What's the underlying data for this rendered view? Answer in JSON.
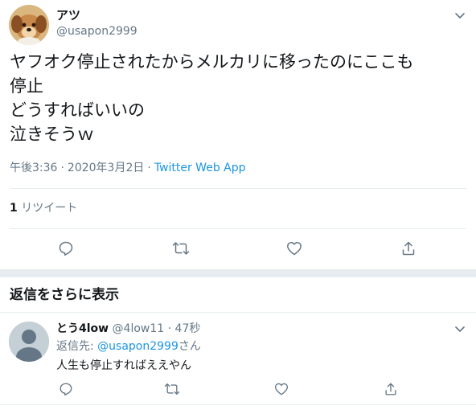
{
  "main_tweet": {
    "author_name": "アツ",
    "author_handle": "@usapon2999",
    "text_lines": [
      "ヤフオク停止されたからメルカリに移ったのにここも",
      "停止",
      "どうすればいいの",
      "泣きそうｗ"
    ],
    "time": "午後3:36",
    "separator": "·",
    "date": "2020年3月2日",
    "client": "Twitter Web App",
    "retweet_count": "1",
    "retweet_label": "リツイート"
  },
  "more_replies_label": "返信をさらに表示",
  "reply": {
    "author_name": "とう4low",
    "author_handle": "@4low11",
    "separator": "·",
    "time": "47秒",
    "reply_to_prefix": "返信先: ",
    "reply_to_handle": "@usapon2999",
    "reply_to_suffix": "さん",
    "text": "人生も停止すればええやん"
  },
  "icons": {
    "reply": "comment-icon",
    "retweet": "retweet-icon",
    "like": "heart-icon",
    "share": "share-icon",
    "menu": "chevron-down-icon"
  },
  "colors": {
    "text": "#14171a",
    "secondary": "#657786",
    "link": "#1b95e0",
    "divider": "#e6ecf0",
    "icon": "#657786"
  }
}
